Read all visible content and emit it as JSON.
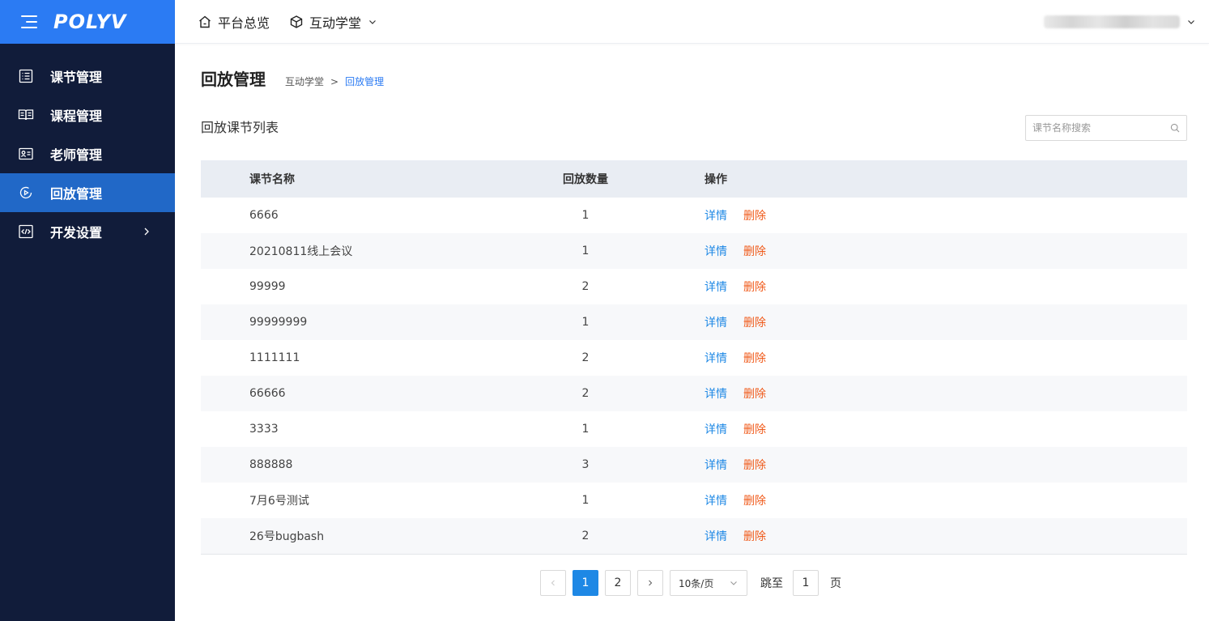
{
  "brand": {
    "logo": "POLYV"
  },
  "sidebar": {
    "items": [
      {
        "label": "课节管理",
        "icon": "list-icon",
        "active": false
      },
      {
        "label": "课程管理",
        "icon": "book-icon",
        "active": false
      },
      {
        "label": "老师管理",
        "icon": "id-card-icon",
        "active": false
      },
      {
        "label": "回放管理",
        "icon": "play-circle-icon",
        "active": true
      },
      {
        "label": "开发设置",
        "icon": "code-icon",
        "active": false
      }
    ]
  },
  "topbar": {
    "home_label": "平台总览",
    "school_label": "互动学堂"
  },
  "page": {
    "title": "回放管理",
    "breadcrumb_parent": "互动学堂",
    "breadcrumb_sep": ">",
    "breadcrumb_current": "回放管理",
    "section_title": "回放课节列表"
  },
  "search": {
    "placeholder": "课节名称搜索"
  },
  "table": {
    "headers": {
      "name": "课节名称",
      "count": "回放数量",
      "ops": "操作"
    },
    "detail_label": "详情",
    "delete_label": "删除",
    "rows": [
      {
        "name": "6666",
        "count": "1"
      },
      {
        "name": "20210811线上会议",
        "count": "1"
      },
      {
        "name": "99999",
        "count": "2"
      },
      {
        "name": "99999999",
        "count": "1"
      },
      {
        "name": "1111111",
        "count": "2"
      },
      {
        "name": "66666",
        "count": "2"
      },
      {
        "name": "3333",
        "count": "1"
      },
      {
        "name": "888888",
        "count": "3"
      },
      {
        "name": "7月6号测试",
        "count": "1"
      },
      {
        "name": "26号bugbash",
        "count": "2"
      }
    ]
  },
  "pager": {
    "pages": [
      "1",
      "2"
    ],
    "current": "1",
    "page_size": "10条/页",
    "jump_label": "跳至",
    "jump_value": "1",
    "page_unit": "页"
  },
  "colors": {
    "sidebar_bg": "#111c3a",
    "brand_bg": "#2b7bf3",
    "active_item": "#2168c7",
    "link_blue": "#1e88e5",
    "delete_orange": "#f05a1a"
  }
}
